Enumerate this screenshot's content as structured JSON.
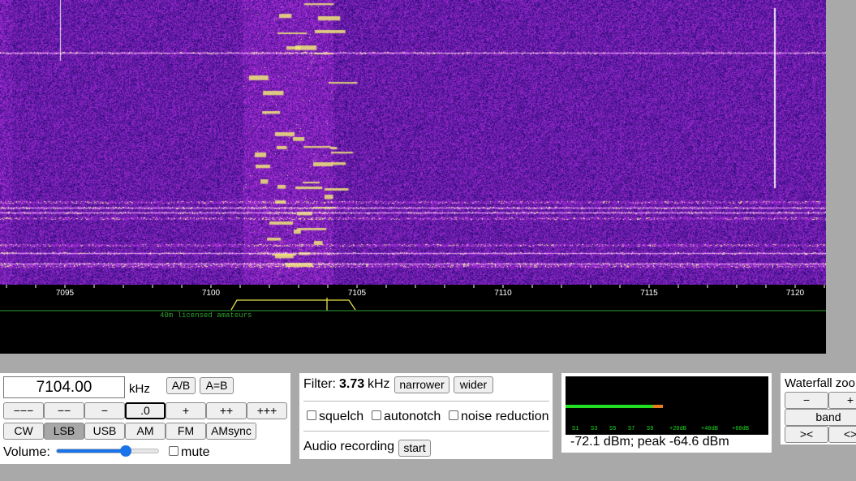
{
  "waterfall": {
    "scale_labels": [
      "7095",
      "7100",
      "7105",
      "7110",
      "7115",
      "7120"
    ],
    "band_label": "40m licensed amateurs",
    "colors": {
      "base": "#3a0d8a",
      "mid": "#7b2ad8",
      "hot": "#f0e070",
      "passband": "#e6e04a",
      "band_line": "#2fa030"
    }
  },
  "freq": {
    "value": "7104.00",
    "unit": "kHz",
    "ab_label": "A/B",
    "aeqb_label": "A=B",
    "steps": [
      "−−−",
      "−−",
      "−",
      ".0",
      "+",
      "++",
      "+++"
    ],
    "modes": [
      "CW",
      "LSB",
      "USB",
      "AM",
      "FM",
      "AMsync"
    ],
    "selected_mode": "LSB",
    "volume_label": "Volume:",
    "volume_level": 0.68,
    "mute_label": "mute"
  },
  "filter": {
    "label": "Filter:",
    "width": "3.73",
    "unit": "kHz",
    "narrower_label": "narrower",
    "wider_label": "wider",
    "squelch_label": "squelch",
    "autonotch_label": "autonotch",
    "nr_label": "noise reduction",
    "recording_label": "Audio recording",
    "start_label": "start"
  },
  "smeter": {
    "scale": [
      "S1",
      "S3",
      "S5",
      "S7",
      "S9",
      "+20dB",
      "+40dB",
      "+60dB"
    ],
    "level_fraction": 0.43,
    "peak_fraction": 0.48,
    "colors": {
      "bar": "#22dd22",
      "peak": "#e67e22",
      "text": "#22dd22"
    },
    "readout": "-72.1 dBm; peak  -64.6 dBm"
  },
  "wf_panel": {
    "title": "Waterfall zoom",
    "minus_label": "−",
    "plus_label": "+",
    "band_label": "band",
    "left_label": "><",
    "right_label": "<>"
  }
}
